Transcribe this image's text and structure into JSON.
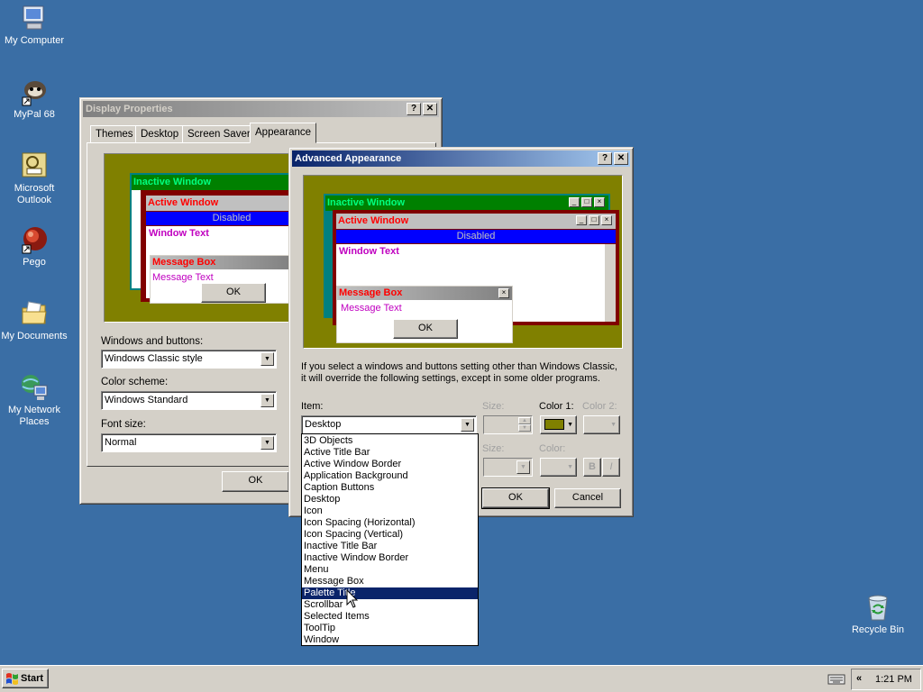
{
  "colors": {
    "desktop": "#3a6ea5",
    "face": "#d4d0c8",
    "olive": "#808000",
    "maroon": "#800000",
    "teal": "#008080",
    "active_title_text": "#ff0000",
    "inactive_title_text": "#00ff80",
    "window_text": "#c000c0",
    "selection": "#0a246a"
  },
  "desktop_icons": [
    {
      "label": "My Computer",
      "icon": "computer-icon"
    },
    {
      "label": "MyPal 68",
      "icon": "mypal-icon"
    },
    {
      "label": "Microsoft Outlook",
      "icon": "outlook-icon"
    },
    {
      "label": "Pego",
      "icon": "pego-icon"
    },
    {
      "label": "My Documents",
      "icon": "folder-icon"
    },
    {
      "label": "My Network Places",
      "icon": "network-icon"
    },
    {
      "label": "Recycle Bin",
      "icon": "recycle-bin-icon"
    }
  ],
  "display_properties": {
    "title": "Display Properties",
    "help_btn": "?",
    "close_btn": "✕",
    "tabs": [
      "Themes",
      "Desktop",
      "Screen Saver",
      "Appearance"
    ],
    "preview": {
      "inactive_title": "Inactive Window",
      "active_title": "Active Window",
      "disabled": "Disabled",
      "window_text": "Window Text",
      "message_box": "Message Box",
      "message_text": "Message Text",
      "ok": "OK"
    },
    "windows_buttons_label": "Windows and buttons:",
    "windows_buttons_value": "Windows Classic style",
    "color_scheme_label": "Color scheme:",
    "color_scheme_value": "Windows Standard",
    "font_size_label": "Font size:",
    "font_size_value": "Normal",
    "ok": "OK"
  },
  "advanced_appearance": {
    "title": "Advanced Appearance",
    "help_btn": "?",
    "close_btn": "✕",
    "preview": {
      "inactive_title": "Inactive Window",
      "active_title": "Active Window",
      "disabled": "Disabled",
      "window_text": "Window Text",
      "message_box": "Message Box",
      "message_text": "Message Text",
      "ok": "OK"
    },
    "info_line1": "If you select a windows and buttons setting other than Windows Classic,",
    "info_line2": "it will override the following settings, except in some older programs.",
    "item_label": "Item:",
    "item_value": "Desktop",
    "size_label": "Size:",
    "color1_label": "Color 1:",
    "color2_label": "Color 2:",
    "font_label_size": "Size:",
    "font_label_color": "Color:",
    "bold": "B",
    "italic": "I",
    "ok": "OK",
    "cancel": "Cancel",
    "item_list": [
      "3D Objects",
      "Active Title Bar",
      "Active Window Border",
      "Application Background",
      "Caption Buttons",
      "Desktop",
      "Icon",
      "Icon Spacing (Horizontal)",
      "Icon Spacing (Vertical)",
      "Inactive Title Bar",
      "Inactive Window Border",
      "Menu",
      "Message Box",
      "Palette Title",
      "Scrollbar",
      "Selected Items",
      "ToolTip",
      "Window"
    ],
    "highlighted_item": "Palette Title"
  },
  "taskbar": {
    "start": "Start",
    "time": "1:21 PM",
    "chevron": "«"
  }
}
